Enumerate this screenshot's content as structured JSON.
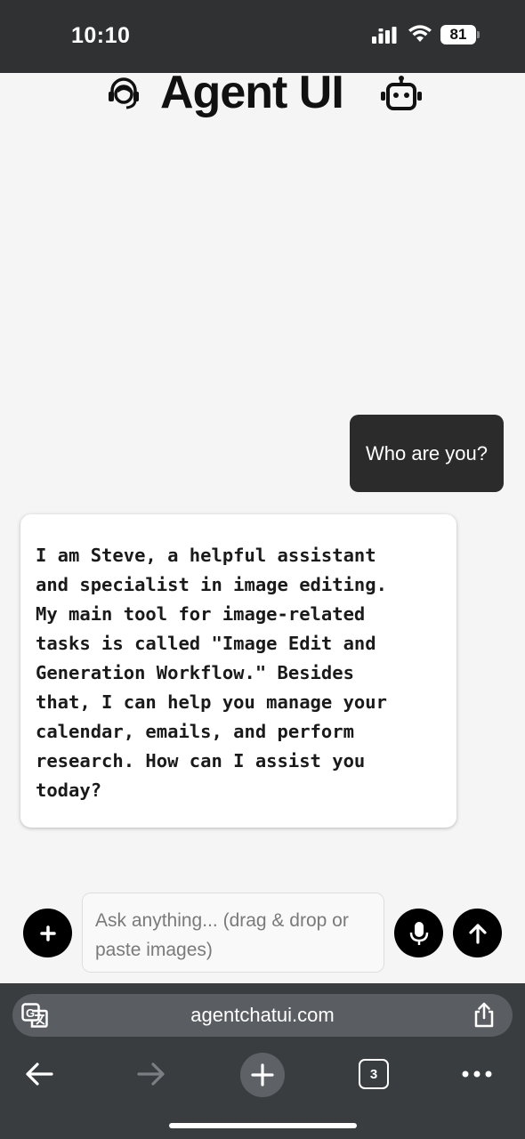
{
  "status_bar": {
    "time": "10:10",
    "battery_level": "81",
    "icons": [
      "signal-icon",
      "wifi-icon",
      "battery-icon"
    ]
  },
  "header": {
    "title": "Agent UI",
    "left_icon": "headset-support-icon",
    "right_icon": "robot-icon"
  },
  "chat": {
    "messages": [
      {
        "role": "user",
        "text": "Who are you?"
      },
      {
        "role": "assistant",
        "text": "I am Steve, a helpful assistant\nand specialist in image editing.\nMy main tool for image-related\ntasks is called \"Image Edit and\nGeneration Workflow.\" Besides\nthat, I can help you manage your\ncalendar, emails, and perform\nresearch. How can I assist you\ntoday?"
      }
    ]
  },
  "composer": {
    "placeholder": "Ask anything... (drag & drop or paste images)",
    "value": "",
    "icons": [
      "plus-icon",
      "microphone-icon",
      "arrow-up-icon"
    ]
  },
  "browser": {
    "url": "agentchatui.com",
    "tab_count": "3",
    "icons": [
      "translate-icon",
      "share-icon",
      "back-arrow-icon",
      "forward-arrow-icon",
      "new-tab-plus-icon",
      "tabs-icon",
      "more-icon"
    ]
  },
  "colors": {
    "status_bar_bg": "#2f3133",
    "page_bg": "#f5f5f5",
    "user_bubble_bg": "#2b2b2b",
    "assistant_bubble_bg": "#ffffff",
    "button_bg": "#000000",
    "browser_bar_bg": "#3a3d40"
  }
}
